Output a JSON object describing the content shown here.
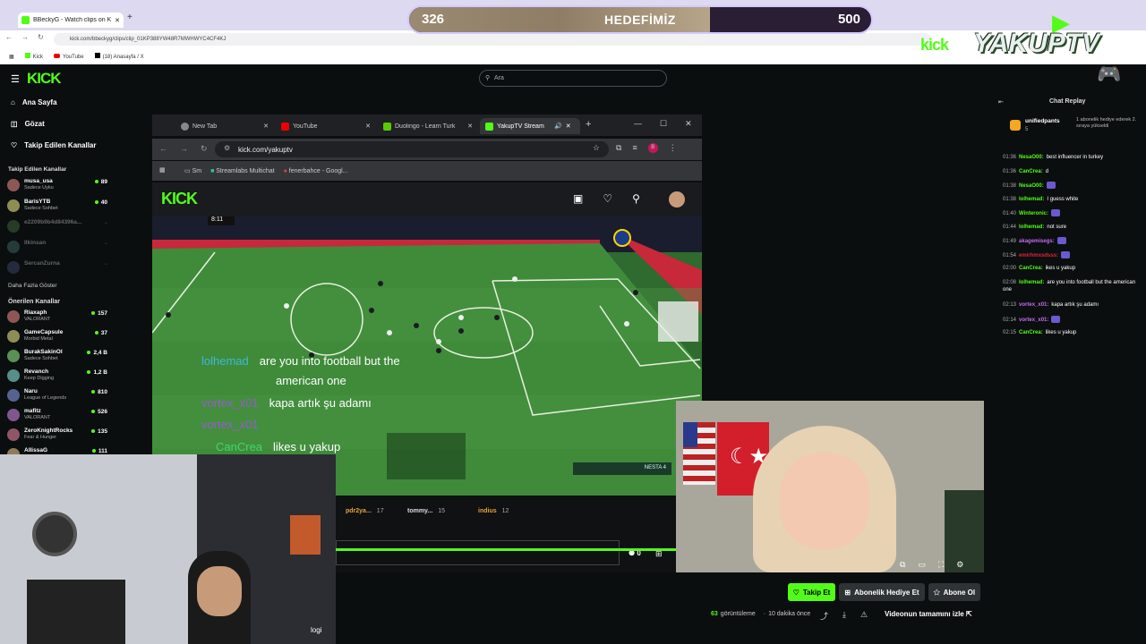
{
  "outer_browser": {
    "tab_title": "BBeckyG - Watch clips on K",
    "new_tab": "+",
    "url": "kick.com/bbeckyg/clips/clip_01KP388YW48R7MWHWYC4CF4KJ",
    "bookmarks": [
      "Kick",
      "YouTube",
      "(18) Anasayfa / X"
    ]
  },
  "goal": {
    "current": "326",
    "title": "HEDEFİMİZ",
    "max": "500",
    "progress": 0.652
  },
  "overlay_logo": {
    "kick": "kick",
    "brand": "YAKUPTV"
  },
  "site": {
    "logo": "KICK",
    "search_placeholder": "Ara",
    "nav": [
      "Ana Sayfa",
      "Gözat",
      "Takip Edilen Kanallar"
    ],
    "followed_heading": "Takip Edilen Kanallar",
    "followed": [
      {
        "name": "musa_usa",
        "sub": "Sadece Uyku",
        "count": "89"
      },
      {
        "name": "BarisYTB",
        "sub": "Sadece Sohbet",
        "count": "40"
      },
      {
        "name": "e2209b9b4d84396a...",
        "sub": "",
        "count": ""
      },
      {
        "name": "Ilkinsan",
        "sub": "",
        "count": ""
      },
      {
        "name": "SercanZurna",
        "sub": "",
        "count": ""
      }
    ],
    "show_more": "Daha Fazla Göster",
    "recommended_heading": "Önerilen Kanallar",
    "recommended": [
      {
        "name": "Riaxaph",
        "sub": "VALORANT",
        "count": "157"
      },
      {
        "name": "GameCapsule",
        "sub": "Morbid Metal",
        "count": "37"
      },
      {
        "name": "BurakSakinOl",
        "sub": "Sadece Sohbet",
        "count": "2,4 B"
      },
      {
        "name": "Revanch",
        "sub": "Keep Digging",
        "count": "1,2 B"
      },
      {
        "name": "Naru",
        "sub": "League of Legends",
        "count": "810"
      },
      {
        "name": "mafitz",
        "sub": "VALORANT",
        "count": "526"
      },
      {
        "name": "ZeroKnightRocks",
        "sub": "Fear & Hunger",
        "count": "135"
      },
      {
        "name": "AllissaG",
        "sub": "",
        "count": "111"
      }
    ]
  },
  "inner_browser": {
    "tabs": [
      "New Tab",
      "YouTube",
      "Duolingo - Learn Turk",
      "YakupTV Stream"
    ],
    "url": "kick.com/yakuptv",
    "bookmarks": [
      "Sm",
      "Streamlabs Multichat",
      "fenerbahce - Googl..."
    ],
    "logo": "KICK"
  },
  "chat_overlay": [
    {
      "user": "lolhemad",
      "text": "are you into football but the",
      "color": "#3fb8d8"
    },
    {
      "user": "",
      "text": "american one",
      "color": "#3fb8d8"
    },
    {
      "user": "vortex_x01",
      "text": "kapa artık şu adamı",
      "color": "#9b59d0"
    },
    {
      "user": "vortex_x01",
      "text": "",
      "color": "#9b59d0"
    },
    {
      "user": "CanCrea",
      "text": "likes u yakup",
      "color": "#3fd86a"
    }
  ],
  "game_hud": {
    "score": "8:11",
    "player": "NESTA 4"
  },
  "leaderboard": [
    {
      "name": "pdr2ya...",
      "count": "17"
    },
    {
      "name": "tommy...",
      "count": "15"
    },
    {
      "name": "indius",
      "count": "12"
    }
  ],
  "player": {
    "viewers_live": "0"
  },
  "cam_label": "logi",
  "chat": {
    "header": "Chat Replay",
    "pinned_user": "unifiedpants",
    "pinned_count": "5",
    "pinned_text": "1 abonelik hediye ederek 2. sıraya yükseldi",
    "messages": [
      {
        "time": "01:36",
        "user": "NesaO00:",
        "text": "best influencer in turkey",
        "color": "#53fc18"
      },
      {
        "time": "01:36",
        "user": "CanCrea:",
        "text": "d",
        "color": "#53fc18"
      },
      {
        "time": "01:38",
        "user": "NesaO00:",
        "text": "",
        "color": "#53fc18"
      },
      {
        "time": "01:38",
        "user": "lolhemad:",
        "text": "I guess white",
        "color": "#53fc18"
      },
      {
        "time": "01:40",
        "user": "Winteronic:",
        "text": "",
        "color": "#53fc18"
      },
      {
        "time": "01:44",
        "user": "lolhemad:",
        "text": "not sure",
        "color": "#53fc18"
      },
      {
        "time": "01:49",
        "user": "akagemisegs:",
        "text": "",
        "color": "#c56cf0"
      },
      {
        "time": "01:54",
        "user": "emirhmxsdsss:",
        "text": "",
        "color": "#e0243d"
      },
      {
        "time": "02:00",
        "user": "CanCrea:",
        "text": "ikes u yakup",
        "color": "#53fc18"
      },
      {
        "time": "02:08",
        "user": "lolhemad:",
        "text": "are you into football but the american one",
        "color": "#53fc18"
      },
      {
        "time": "02:13",
        "user": "vortex_x01:",
        "text": "kapa artık şu adamı",
        "color": "#c56cf0"
      },
      {
        "time": "02:14",
        "user": "vortex_x01:",
        "text": "",
        "color": "#c56cf0"
      },
      {
        "time": "02:15",
        "user": "CanCrea:",
        "text": "likes u yakup",
        "color": "#53fc18"
      }
    ]
  },
  "actions": {
    "follow": "Takip Et",
    "gift": "Abonelik Hediye Et",
    "subscribe": "Abone Ol",
    "views_count": "63",
    "views_label": "görüntüleme",
    "ago": "10 dakika önce",
    "watch_full": "Videonun tamamını izle"
  },
  "colors": {
    "kick_green": "#53fc18",
    "bg": "#0b0e0f"
  }
}
